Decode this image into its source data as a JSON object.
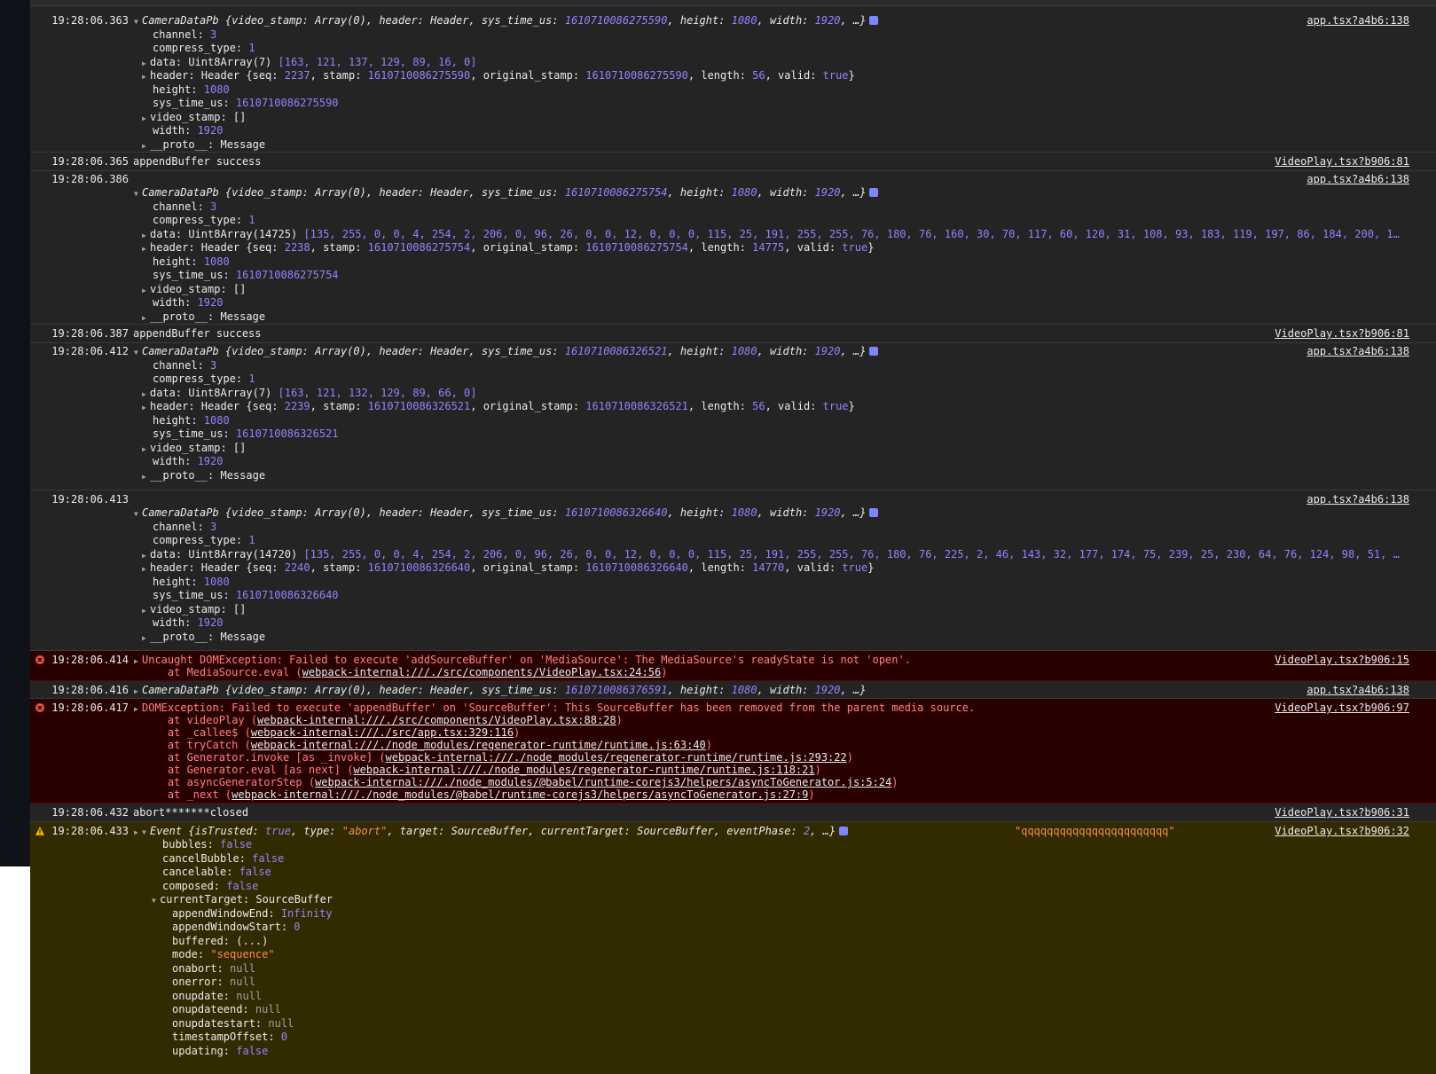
{
  "colors": {
    "console_bg": "#242424",
    "error_bg": "#290000",
    "warning_bg": "#332b00",
    "number": "#9980ff",
    "string": "#f28b54"
  },
  "icons": {
    "error": "error-circle-icon",
    "warning": "warning-triangle-icon",
    "expand": "expand-triangle-icon",
    "info": "info-badge-icon"
  },
  "e1": {
    "ts": "19:28:06.363",
    "src": "app.tsx?a4b6:138",
    "s_name": "CameraDataPb",
    "s_a": " {video_stamp: Array(0), header: Header, sys_time_us: ",
    "s_time": "1610710086275590",
    "s_b": ", height: ",
    "s_h": "1080",
    "s_c": ", width: ",
    "s_w": "1920",
    "s_d": ", …}",
    "channel": "3",
    "compress": "1",
    "data_type": "Uint8Array(7) ",
    "data_val": "[163, 121, 137, 129, 89, 16, 0]",
    "hdr_a": "Header {seq: ",
    "seq": "2237",
    "hdr_b": ", stamp: ",
    "stamp": "1610710086275590",
    "hdr_c": ", original_stamp: ",
    "orig": "1610710086275590",
    "hdr_d": ", length: ",
    "len": "56",
    "hdr_e": ", valid: ",
    "valid": "true",
    "hdr_f": "}",
    "height": "1080",
    "sys": "1610710086275590",
    "vs": "[]",
    "width": "1920",
    "proto": "Message"
  },
  "e2": {
    "ts": "19:28:06.365",
    "msg": "appendBuffer success",
    "src": "VideoPlay.tsx?b906:81"
  },
  "e3": {
    "ts": "19:28:06.386",
    "src": "app.tsx?a4b6:138",
    "s_name": "CameraDataPb",
    "s_a": " {video_stamp: Array(0), header: Header, sys_time_us: ",
    "s_time": "1610710086275754",
    "s_b": ", height: ",
    "s_h": "1080",
    "s_c": ", width: ",
    "s_w": "1920",
    "s_d": ", …}",
    "channel": "3",
    "compress": "1",
    "data_type": "Uint8Array(14725) ",
    "data_val": "[135, 255, 0, 0, 4, 254, 2, 206, 0, 96, 26, 0, 0, 12, 0, 0, 0, 115, 25, 191, 255, 255, 76, 180, 76, 160, 30, 70, 117, 60, 120, 31, 108, 93, 183, 119, 197, 86, 184, 200, 1…",
    "hdr_a": "Header {seq: ",
    "seq": "2238",
    "hdr_b": ", stamp: ",
    "stamp": "1610710086275754",
    "hdr_c": ", original_stamp: ",
    "orig": "1610710086275754",
    "hdr_d": ", length: ",
    "len": "14775",
    "hdr_e": ", valid: ",
    "valid": "true",
    "hdr_f": "}",
    "height": "1080",
    "sys": "1610710086275754",
    "vs": "[]",
    "width": "1920",
    "proto": "Message"
  },
  "e4": {
    "ts": "19:28:06.387",
    "msg": "appendBuffer success",
    "src": "VideoPlay.tsx?b906:81"
  },
  "e5": {
    "ts": "19:28:06.412",
    "src": "app.tsx?a4b6:138",
    "s_name": "CameraDataPb",
    "s_a": " {video_stamp: Array(0), header: Header, sys_time_us: ",
    "s_time": "1610710086326521",
    "s_b": ", height: ",
    "s_h": "1080",
    "s_c": ", width: ",
    "s_w": "1920",
    "s_d": ", …}",
    "channel": "3",
    "compress": "1",
    "data_type": "Uint8Array(7) ",
    "data_val": "[163, 121, 132, 129, 89, 66, 0]",
    "hdr_a": "Header {seq: ",
    "seq": "2239",
    "hdr_b": ", stamp: ",
    "stamp": "1610710086326521",
    "hdr_c": ", original_stamp: ",
    "orig": "1610710086326521",
    "hdr_d": ", length: ",
    "len": "56",
    "hdr_e": ", valid: ",
    "valid": "true",
    "hdr_f": "}",
    "height": "1080",
    "sys": "1610710086326521",
    "vs": "[]",
    "width": "1920",
    "proto": "Message"
  },
  "e6": {
    "ts": "19:28:06.413",
    "src": "app.tsx?a4b6:138",
    "s_name": "CameraDataPb",
    "s_a": " {video_stamp: Array(0), header: Header, sys_time_us: ",
    "s_time": "1610710086326640",
    "s_b": ", height: ",
    "s_h": "1080",
    "s_c": ", width: ",
    "s_w": "1920",
    "s_d": ", …}",
    "channel": "3",
    "compress": "1",
    "data_type": "Uint8Array(14720) ",
    "data_val": "[135, 255, 0, 0, 4, 254, 2, 206, 0, 96, 26, 0, 0, 12, 0, 0, 0, 115, 25, 191, 255, 255, 76, 180, 76, 225, 2, 46, 143, 32, 177, 174, 75, 239, 25, 230, 64, 76, 124, 98, 51, …",
    "hdr_a": "Header {seq: ",
    "seq": "2240",
    "hdr_b": ", stamp: ",
    "stamp": "1610710086326640",
    "hdr_c": ", original_stamp: ",
    "orig": "1610710086326640",
    "hdr_d": ", length: ",
    "len": "14770",
    "hdr_e": ", valid: ",
    "valid": "true",
    "hdr_f": "}",
    "height": "1080",
    "sys": "1610710086326640",
    "vs": "[]",
    "width": "1920",
    "proto": "Message"
  },
  "e7": {
    "ts": "19:28:06.414",
    "src": "VideoPlay.tsx?b906:15",
    "msg": "Uncaught DOMException: Failed to execute 'addSourceBuffer' on 'MediaSource': The MediaSource's readyState is not 'open'.",
    "at_pre": "    at MediaSource.eval (",
    "at_link": "webpack-internal:///./src/components/VideoPlay.tsx:24:56",
    "at_post": ")"
  },
  "e8": {
    "ts": "19:28:06.416",
    "src": "app.tsx?a4b6:138",
    "s_name": "CameraDataPb",
    "s_a": " {video_stamp: Array(0), header: Header, sys_time_us: ",
    "s_time": "1610710086376591",
    "s_b": ", height: ",
    "s_h": "1080",
    "s_c": ", width: ",
    "s_w": "1920",
    "s_d": ", …}"
  },
  "e9": {
    "ts": "19:28:06.417",
    "src": "VideoPlay.tsx?b906:97",
    "msg": "DOMException: Failed to execute 'appendBuffer' on 'SourceBuffer': This SourceBuffer has been removed from the parent media source.",
    "s1_pre": "    at videoPlay (",
    "s1_link": "webpack-internal:///./src/components/VideoPlay.tsx:88:28",
    "s1_post": ")",
    "s2_pre": "    at _callee$ (",
    "s2_link": "webpack-internal:///./src/app.tsx:329:116",
    "s2_post": ")",
    "s3_pre": "    at tryCatch (",
    "s3_link": "webpack-internal:///./node_modules/regenerator-runtime/runtime.js:63:40",
    "s3_post": ")",
    "s4_pre": "    at Generator.invoke [as _invoke] (",
    "s4_link": "webpack-internal:///./node_modules/regenerator-runtime/runtime.js:293:22",
    "s4_post": ")",
    "s5_pre": "    at Generator.eval [as next] (",
    "s5_link": "webpack-internal:///./node_modules/regenerator-runtime/runtime.js:118:21",
    "s5_post": ")",
    "s6_pre": "    at asyncGeneratorStep (",
    "s6_link": "webpack-internal:///./node_modules/@babel/runtime-corejs3/helpers/asyncToGenerator.js:5:24",
    "s6_post": ")",
    "s7_pre": "    at _next (",
    "s7_link": "webpack-internal:///./node_modules/@babel/runtime-corejs3/helpers/asyncToGenerator.js:27:9",
    "s7_post": ")"
  },
  "e10": {
    "ts": "19:28:06.432",
    "msg": "abort*******closed",
    "src": "VideoPlay.tsx?b906:31"
  },
  "e11": {
    "ts": "19:28:06.433",
    "src": "VideoPlay.tsx?b906:32",
    "s_name": "Event",
    "s_a": " {isTrusted: ",
    "s_trusted": "true",
    "s_b": ", type: ",
    "s_type": "\"abort\"",
    "s_c": ", target: SourceBuffer, currentTarget: SourceBuffer, eventPhase: ",
    "s_phase": "2",
    "s_d": ", …}",
    "qstr": "\"qqqqqqqqqqqqqqqqqqqqqqq\"",
    "bubbles": "false",
    "cancelBubble": "false",
    "cancelable": "false",
    "composed": "false",
    "currentTarget": "SourceBuffer",
    "appendWindowEnd": "Infinity",
    "appendWindowStart": "0",
    "buffered": "(...)",
    "mode": "\"sequence\"",
    "onabort": "null",
    "onerror": "null",
    "onupdate": "null",
    "onupdateend": "null",
    "onupdatestart": "null",
    "timestampOffset": "0",
    "updating": "false"
  }
}
